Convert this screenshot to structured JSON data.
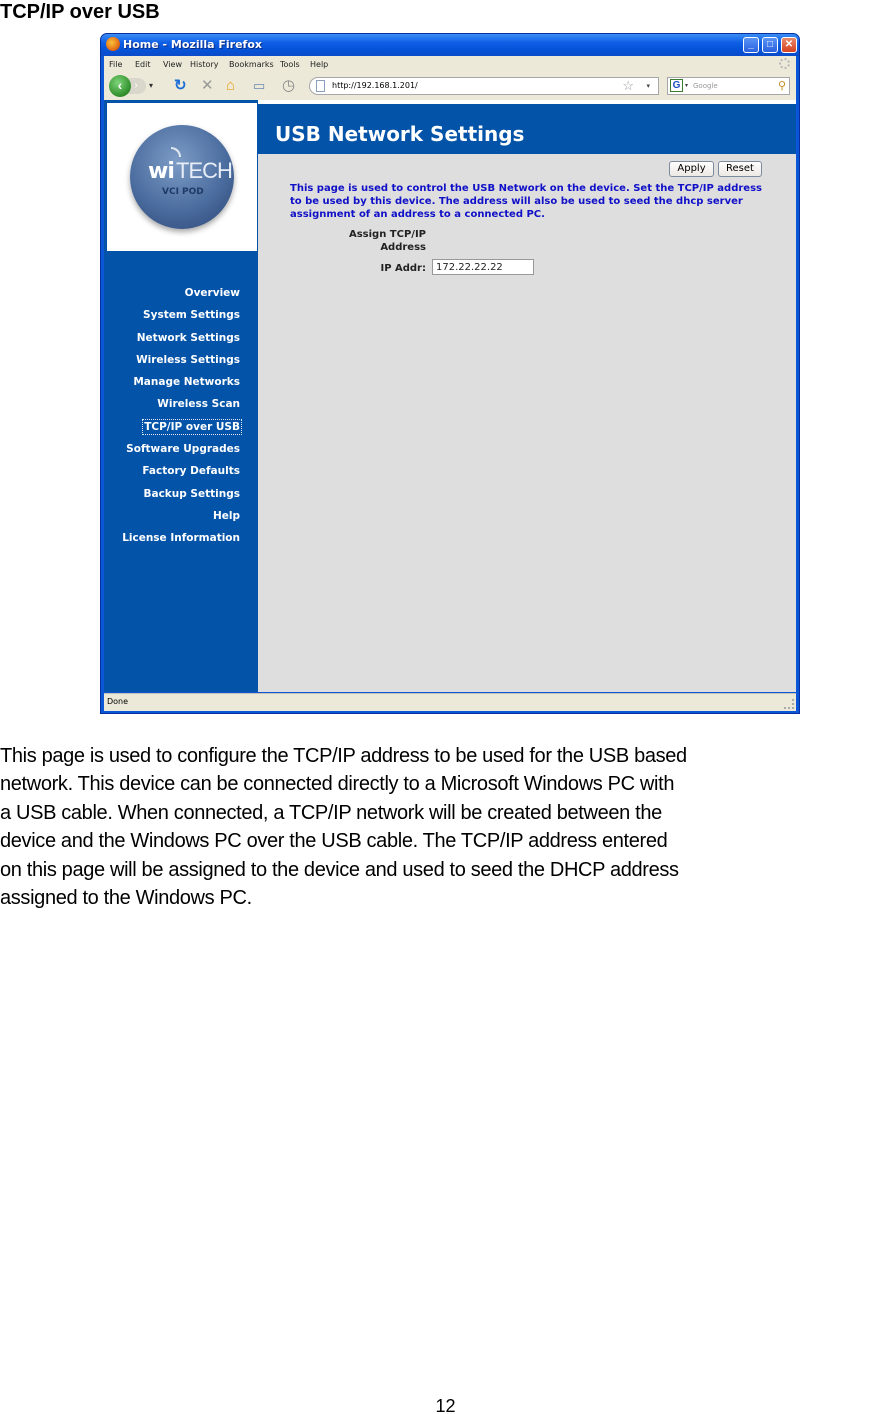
{
  "document": {
    "heading": "TCP/IP over USB",
    "body_lines": [
      "This page is used to configure the TCP/IP address to be used for the USB based",
      "network.  This device can be connected directly to a Microsoft Windows PC with",
      "a USB cable.  When connected, a TCP/IP network will be created between the",
      "device and the Windows PC over the USB cable.  The TCP/IP address entered",
      "on this page will be assigned to the device and used to seed the DHCP address",
      "assigned to the Windows PC."
    ],
    "page_number": "12"
  },
  "browser": {
    "title": "Home - Mozilla Firefox",
    "menu": [
      "File",
      "Edit",
      "View",
      "History",
      "Bookmarks",
      "Tools",
      "Help"
    ],
    "url": "http://192.168.1.201/",
    "search_placeholder": "Google",
    "status": "Done",
    "window_buttons": {
      "minimize": "_",
      "maximize": "□",
      "close": "✕"
    }
  },
  "sidebar": {
    "logo": {
      "brand_wi": "wi",
      "brand_tech": "TECH",
      "subtitle": "VCI POD"
    },
    "items": [
      {
        "label": "Overview",
        "active": false
      },
      {
        "label": "System Settings",
        "active": false
      },
      {
        "label": "Network Settings",
        "active": false
      },
      {
        "label": "Wireless Settings",
        "active": false
      },
      {
        "label": "Manage Networks",
        "active": false
      },
      {
        "label": "Wireless Scan",
        "active": false
      },
      {
        "label": "TCP/IP over USB",
        "active": true
      },
      {
        "label": "Software Upgrades",
        "active": false
      },
      {
        "label": "Factory Defaults",
        "active": false
      },
      {
        "label": "Backup Settings",
        "active": false
      },
      {
        "label": "Help",
        "active": false
      },
      {
        "label": "License Information",
        "active": false
      }
    ]
  },
  "main": {
    "title": "USB Network Settings",
    "apply_label": "Apply",
    "reset_label": "Reset",
    "intro": "This page is used to control the USB Network on the device. Set the TCP/IP address to be used by this device. The address will also be used to seed the dhcp server assignment of an address to a connected PC.",
    "section_label_line1": "Assign TCP/IP",
    "section_label_line2": "Address",
    "ip_label": "IP Addr:",
    "ip_value": "172.22.22.22"
  },
  "colors": {
    "brand_blue": "#0353a8",
    "intro_text": "#1010c8",
    "content_bg": "#dedede"
  }
}
